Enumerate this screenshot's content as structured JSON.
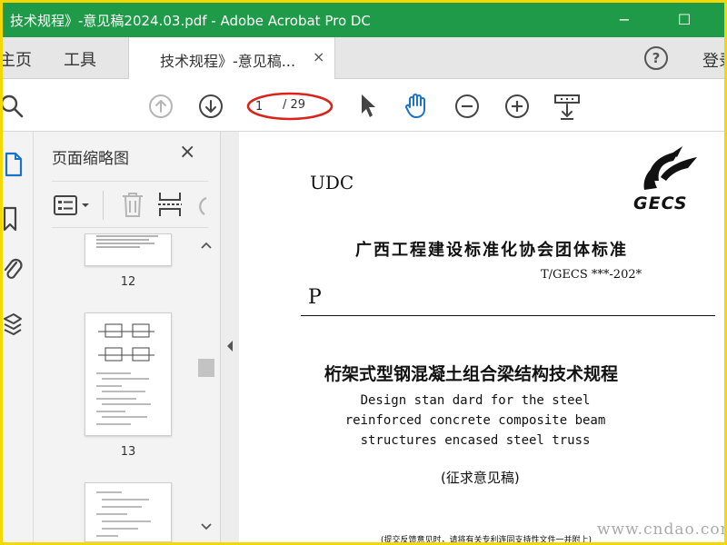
{
  "window": {
    "title": "技术规程》-意见稿2024.03.pdf - Adobe Acrobat Pro DC",
    "minimize_label": "−",
    "maximize_label": "☐"
  },
  "tabs": {
    "home_label": "主页",
    "tools_label": "工具",
    "document_tab_label": "技术规程》-意见稿...",
    "document_tab_close": "×",
    "help_label": "?",
    "login_label": "登录"
  },
  "toolbar": {
    "current_page": "1",
    "total_pages": "/ 29"
  },
  "thumbnails": {
    "title": "页面缩略图",
    "close_label": "×",
    "pages": [
      {
        "number": "12"
      },
      {
        "number": "13"
      },
      {
        "number": ""
      }
    ]
  },
  "document": {
    "udc": "UDC",
    "logo_text": "GECS",
    "organization": "广西工程建设标准化协会团体标准",
    "standard_code": "T/GECS ***-202*",
    "category_letter": "P",
    "title_cn": "桁架式型钢混凝土组合梁结构技术规程",
    "title_en_lines": [
      "Design stan dard for the steel",
      "reinforced concrete composite beam",
      "structures encased steel truss"
    ],
    "draft_label": "(征求意见稿)",
    "footnote": "(提交反馈意见时，请将有关专利连同支持性文件一并附上)"
  },
  "watermark": "www.cndao.com",
  "colors": {
    "titlebar": "#1e9a48",
    "accent_blue": "#1a73c9",
    "highlight_red": "#d9241c",
    "outer_border": "#f5d800"
  }
}
